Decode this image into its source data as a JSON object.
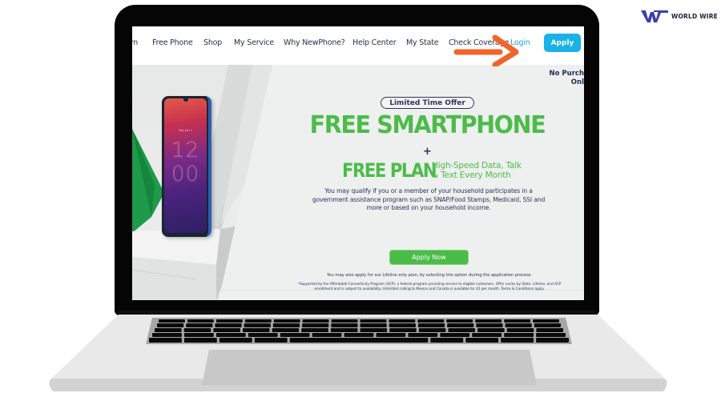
{
  "watermark": {
    "brand_name": "WORLD WIRE",
    "logo_icon": "ww-logo-icon",
    "brand_color": "#3a3fa8"
  },
  "device": {
    "type": "laptop",
    "bezel_color": "#050505",
    "body_color": "#e8e8e8"
  },
  "site": {
    "nav": {
      "items": [
        {
          "label": "m"
        },
        {
          "label": "Free Phone"
        },
        {
          "label": "Shop"
        },
        {
          "label": "My Service"
        },
        {
          "label": "Why NewPhone?"
        },
        {
          "label": "Help Center"
        },
        {
          "label": "My State"
        },
        {
          "label": "Check Coverage"
        },
        {
          "label": "Login"
        }
      ],
      "apply_label": "Apply",
      "apply_color": "#1ab0e8",
      "login_color": "#17a7e0"
    },
    "hero": {
      "side_note_line1": "No Purch",
      "side_note_line2": "Onl",
      "badge": "Limited Time Offer",
      "headline": "FREE SMARTPHONE",
      "plus": "+",
      "plan_title": "FREE PLAN",
      "plan_sub_line1": "High-Speed Data, Talk",
      "plan_sub_line2": "& Text Every Month",
      "qualify_text": "You may qualify if you or a member of your household participates in a government assistance program such as SNAP/Food Stamps, Medicaid, SSI and more or based on your household income.",
      "cta_label": "Apply Now",
      "lifeline_text": "You may also apply for our Lifeline only plan, by selecting this option during the application process.",
      "disclaimer": "*Supported by the Affordable Connectivity Program (ACP), a federal program providing service to eligible customers. Offer varies by State. Lifeline, and ACP enrollment and is subject to availability. Unlimited calling to Mexico and Canada is available for $5 per month. Terms & Conditions apply.",
      "accent_green": "#4cbc49",
      "text_navy": "#2b3558",
      "phone": {
        "clock_hours": "12",
        "clock_minutes": "00",
        "date_text": "Tue, Jan 1"
      }
    },
    "annotation": {
      "type": "arrow",
      "points_to": "Login",
      "color": "#f2642a"
    }
  }
}
